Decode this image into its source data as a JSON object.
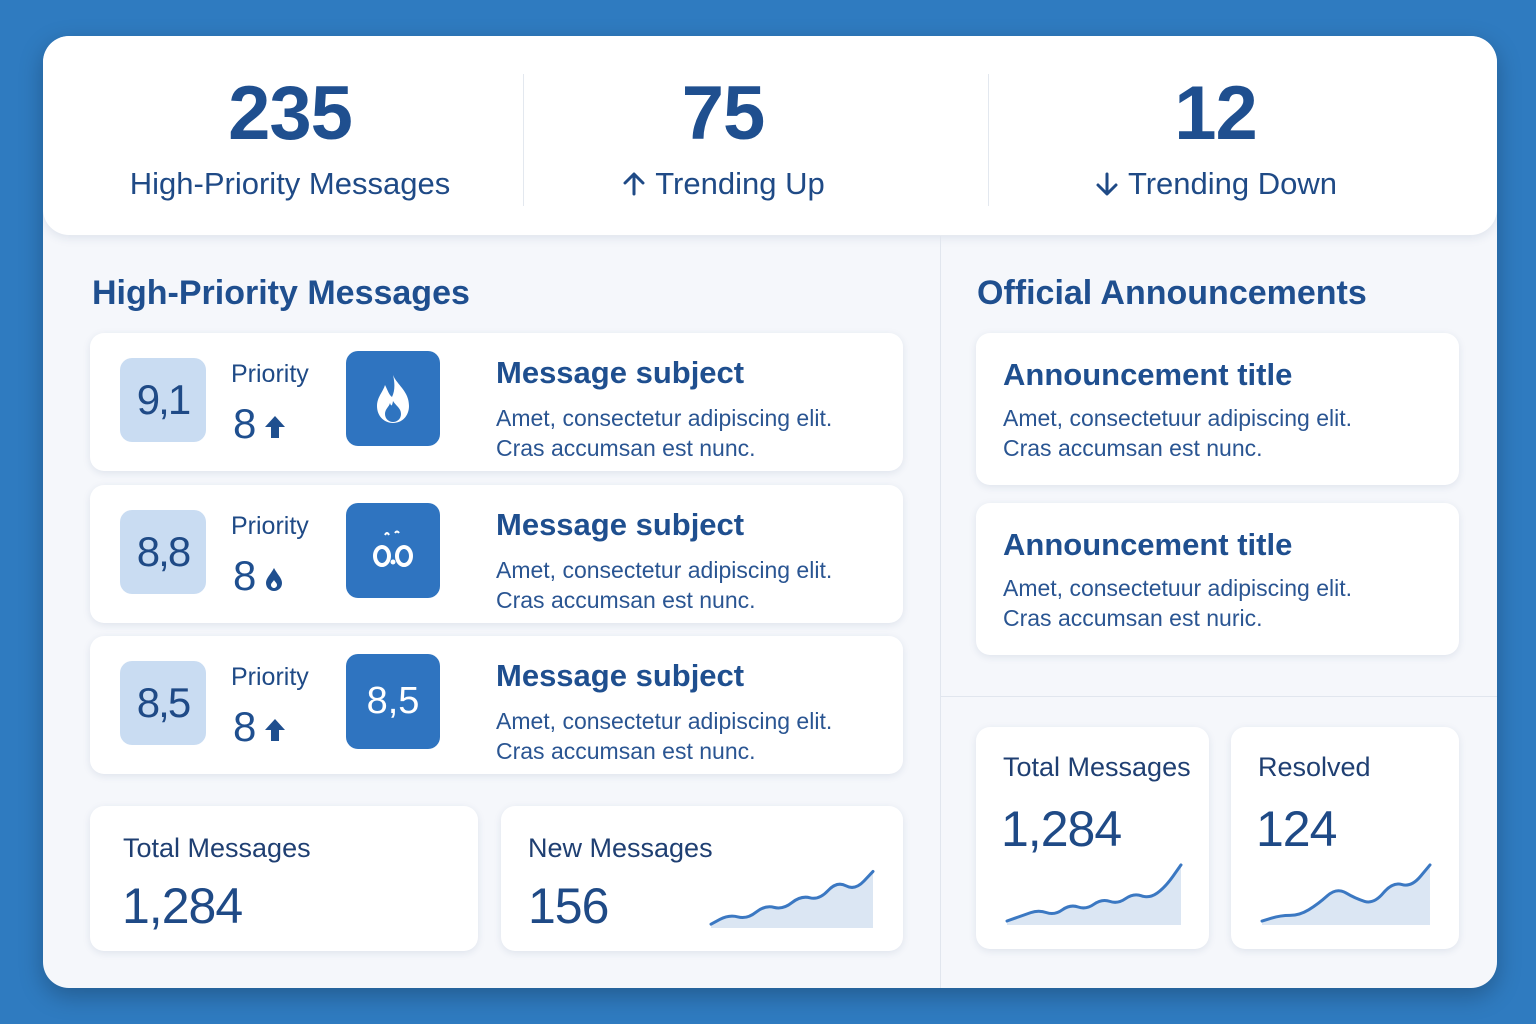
{
  "top_stats": [
    {
      "value": "235",
      "label": "High-Priority Messages",
      "trend": "none"
    },
    {
      "value": "75",
      "label": "Trending Up",
      "trend": "up"
    },
    {
      "value": "12",
      "label": "Trending Down",
      "trend": "down"
    }
  ],
  "messages_section": {
    "title": "High-Priority Messages",
    "items": [
      {
        "score": "9,1",
        "priority_label": "Priority",
        "priority_value": "8",
        "priority_icon": "arrow-up-icon",
        "tile_icon": "flame-icon",
        "tile_text": "",
        "subject": "Message subject",
        "body_line1": "Amet, consectetur adipiscing elit.",
        "body_line2": "Cras accumsan est nunc."
      },
      {
        "score": "8,8",
        "priority_label": "Priority",
        "priority_value": "8",
        "priority_icon": "drop-icon",
        "tile_icon": "face-icon",
        "tile_text": "",
        "subject": "Message subject",
        "body_line1": "Amet, consectetur adipiscing elit.",
        "body_line2": "Cras accumsan est nunc."
      },
      {
        "score": "8,5",
        "priority_label": "Priority",
        "priority_value": "8",
        "priority_icon": "arrow-up-icon",
        "tile_icon": "",
        "tile_text": "8,5",
        "subject": "Message subject",
        "body_line1": "Amet, consectetur adipiscing elit.",
        "body_line2": "Cras accumsan est nunc."
      }
    ]
  },
  "bottom_stats_left": [
    {
      "label": "Total Messages",
      "value": "1,284"
    },
    {
      "label": "New Messages",
      "value": "156",
      "sparkline": [
        3,
        5,
        4,
        7,
        6,
        9,
        8,
        12,
        10,
        14
      ]
    }
  ],
  "announcements_section": {
    "title": "Official Announcements",
    "items": [
      {
        "title": "Announcement title",
        "body_line1": "Amet, consectetuur adipiscing elit.",
        "body_line2": "Cras accumsan est nunc."
      },
      {
        "title": "Announcement title",
        "body_line1": "Amet, consectetuur adipiscing elit.",
        "body_line2": "Cras accumsan est nuric."
      }
    ]
  },
  "bottom_stats_right": [
    {
      "label": "Total Messages",
      "value": "1,284",
      "sparkline": [
        2,
        3,
        4,
        3,
        5,
        4,
        6,
        5,
        7,
        6,
        8,
        12
      ]
    },
    {
      "label": "Resolved",
      "value": "124",
      "sparkline": [
        2,
        3,
        3,
        5,
        8,
        6,
        5,
        9,
        8,
        12
      ]
    }
  ],
  "colors": {
    "background": "#2f7bc0",
    "panel": "#f5f7fb",
    "primary_text": "#1f4f8f",
    "score_tile": "#c9dcf2",
    "icon_tile": "#2f74c0",
    "sparkline_line": "#3b78c2",
    "sparkline_fill": "#dbe6f3"
  }
}
